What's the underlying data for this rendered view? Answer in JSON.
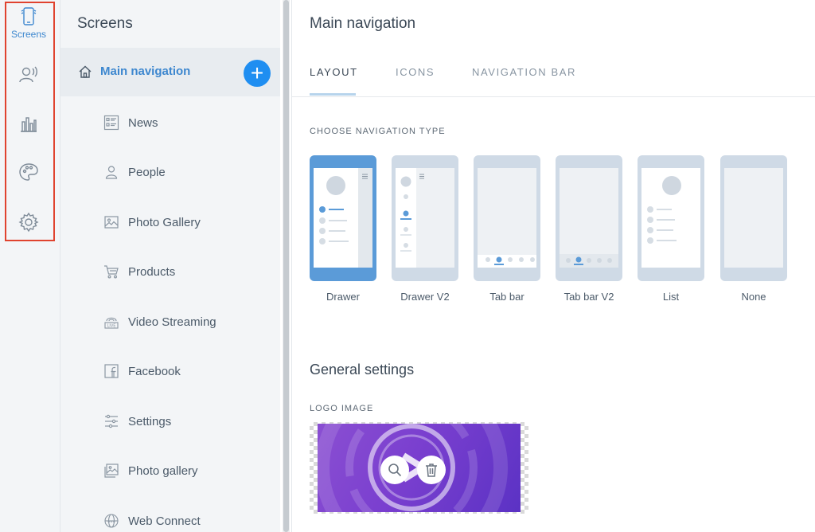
{
  "rail": {
    "items": [
      {
        "icon": "phone-icon",
        "label": "Screens"
      },
      {
        "icon": "broadcast-user-icon"
      },
      {
        "icon": "bar-chart-icon"
      },
      {
        "icon": "palette-icon"
      },
      {
        "icon": "gear-icon"
      }
    ],
    "highlight_color": "#e0432f"
  },
  "screens": {
    "title": "Screens",
    "main_item": {
      "label": "Main navigation",
      "icon": "home-icon"
    },
    "add_label": "+",
    "children": [
      {
        "label": "News",
        "icon": "news-icon"
      },
      {
        "label": "People",
        "icon": "person-icon"
      },
      {
        "label": "Photo Gallery",
        "icon": "image-icon"
      },
      {
        "label": "Products",
        "icon": "cart-icon"
      },
      {
        "label": "Video Streaming",
        "icon": "live-icon"
      },
      {
        "label": "Facebook",
        "icon": "facebook-icon"
      },
      {
        "label": "Settings",
        "icon": "sliders-icon"
      },
      {
        "label": "Photo gallery",
        "icon": "images-icon"
      },
      {
        "label": "Web Connect",
        "icon": "globe-icon"
      }
    ]
  },
  "main": {
    "title": "Main navigation",
    "tabs": [
      {
        "label": "LAYOUT",
        "active": true
      },
      {
        "label": "ICONS",
        "active": false
      },
      {
        "label": "NAVIGATION BAR",
        "active": false
      }
    ],
    "choose_caption": "CHOOSE NAVIGATION TYPE",
    "nav_types": [
      {
        "label": "Drawer",
        "selected": true
      },
      {
        "label": "Drawer V2",
        "selected": false
      },
      {
        "label": "Tab bar",
        "selected": false
      },
      {
        "label": "Tab bar V2",
        "selected": false
      },
      {
        "label": "List",
        "selected": false
      },
      {
        "label": "None",
        "selected": false
      }
    ],
    "general_title": "General settings",
    "logo_caption": "LOGO IMAGE",
    "logo_actions": [
      {
        "icon": "search-icon"
      },
      {
        "icon": "trash-icon"
      }
    ]
  },
  "colors": {
    "accent": "#3d87cf",
    "add_button": "#1f8ef1",
    "selected_phone": "#5b9bd8"
  }
}
